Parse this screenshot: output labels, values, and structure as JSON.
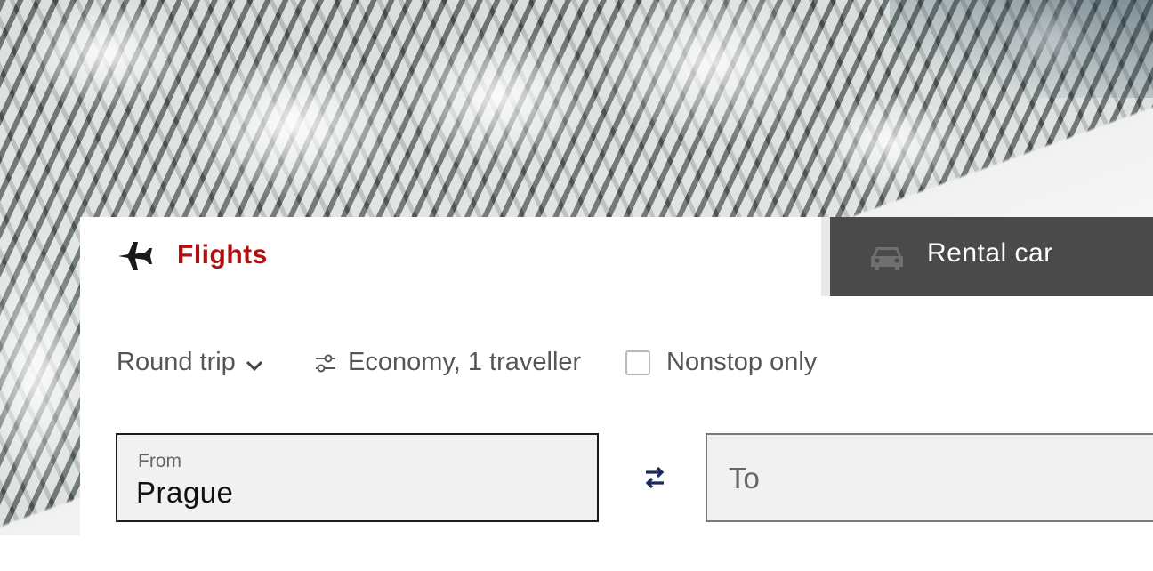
{
  "tabs": {
    "flights": {
      "label": "Flights",
      "icon": "airplane-icon",
      "active": true
    },
    "rental_car": {
      "label": "Rental car",
      "icon": "car-icon",
      "active": false
    }
  },
  "options": {
    "trip_type": {
      "selected": "Round trip",
      "icon": "chevron-down-icon"
    },
    "cabin_travellers": {
      "value": "Economy, 1 traveller",
      "icon": "sliders-icon"
    },
    "nonstop": {
      "label": "Nonstop only",
      "checked": false
    }
  },
  "fields": {
    "from": {
      "label": "From",
      "value": "Prague"
    },
    "to": {
      "placeholder": "To",
      "value": ""
    },
    "swap_icon": "swap-arrows-icon"
  },
  "colors": {
    "accent_red": "#b30d0d",
    "rental_tab_bg": "#4a4a4a",
    "field_bg": "#f1f1f1",
    "swap_icon": "#1a2a5a"
  }
}
